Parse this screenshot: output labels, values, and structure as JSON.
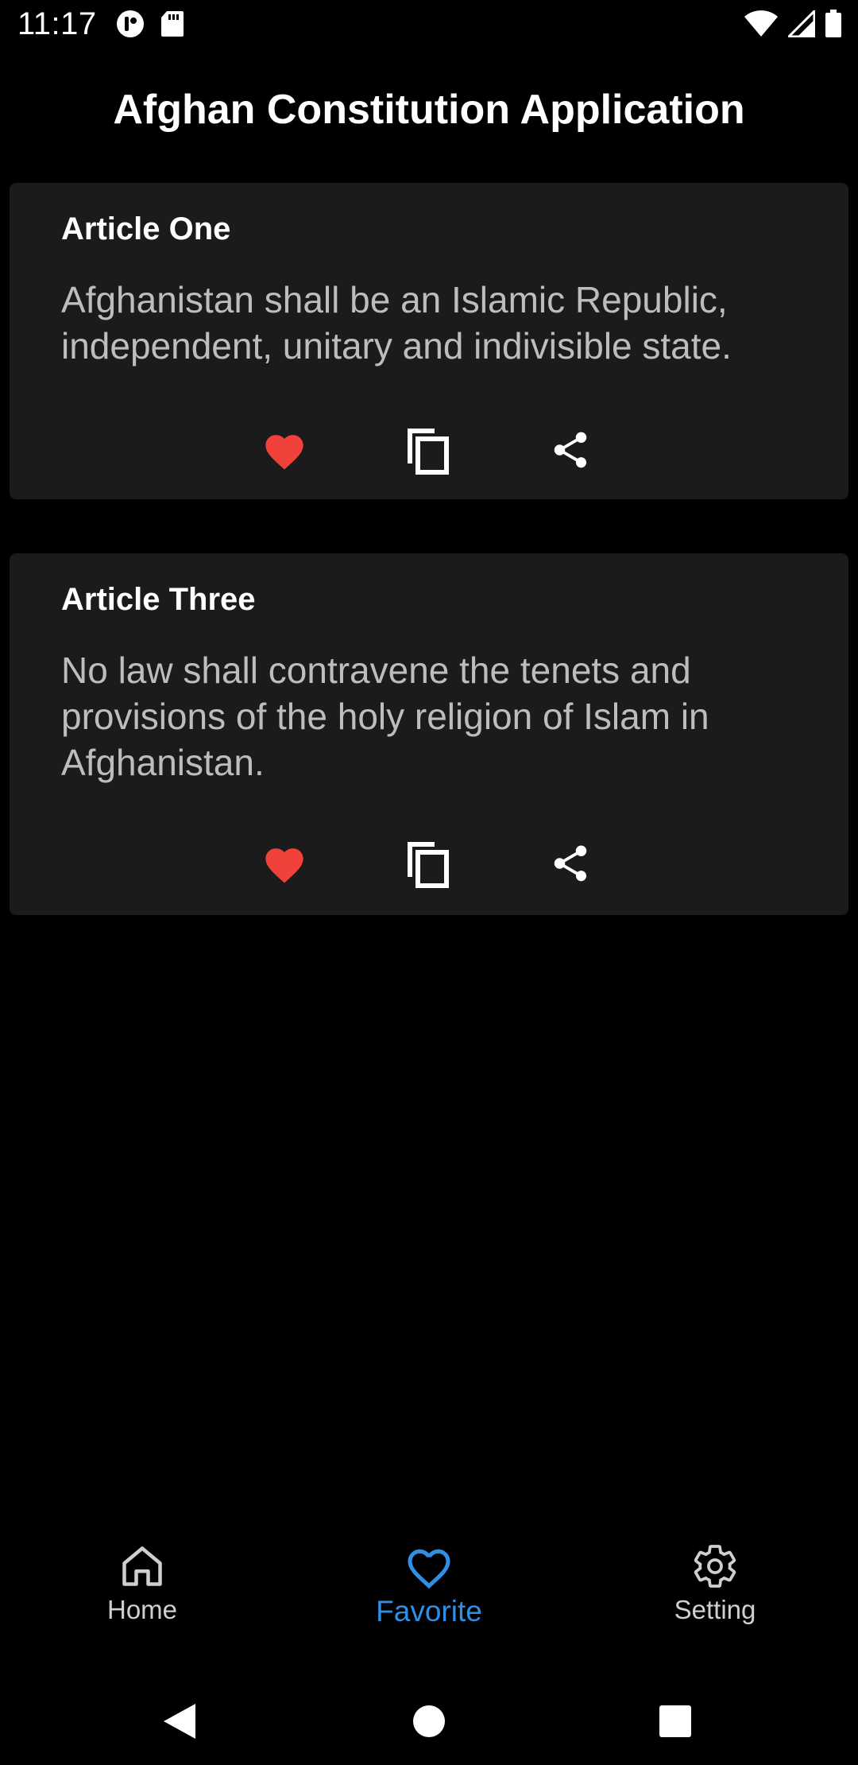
{
  "status_bar": {
    "time": "11:17"
  },
  "app_bar": {
    "title": "Afghan Constitution Application"
  },
  "articles": [
    {
      "title": "Article One",
      "body": "Afghanistan shall be an Islamic Republic, independent, unitary and indivisible state."
    },
    {
      "title": "Article Three",
      "body": "No law shall contravene the tenets and provisions of the holy religion of Islam in Afghanistan."
    }
  ],
  "bottom_nav": {
    "items": [
      {
        "label": "Home",
        "icon": "home-icon"
      },
      {
        "label": "Favorite",
        "icon": "heart-outline-icon",
        "active": true
      },
      {
        "label": "Setting",
        "icon": "gear-icon"
      }
    ]
  },
  "colors": {
    "background": "#000000",
    "card": "#1b1b1c",
    "favorite_red": "#f0413a",
    "accent_blue": "#2f8fe6"
  }
}
